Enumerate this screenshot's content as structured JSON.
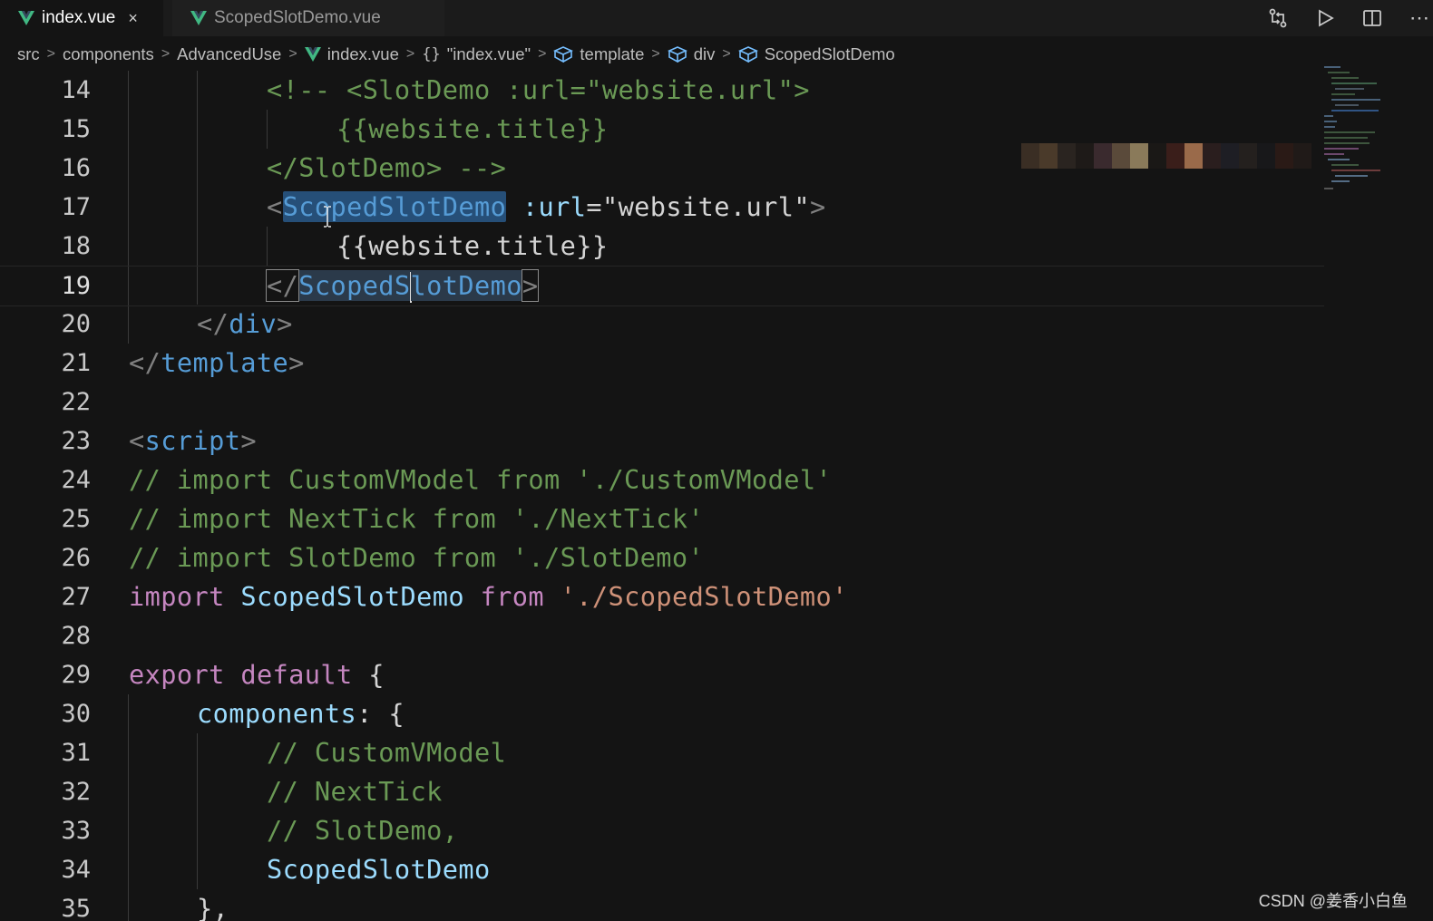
{
  "tabs": [
    {
      "label": "index.vue",
      "active": true,
      "close": "×"
    },
    {
      "label": "ScopedSlotDemo.vue",
      "active": false
    }
  ],
  "breadcrumb": {
    "items": [
      "src",
      "components",
      "AdvancedUse",
      "index.vue",
      "\"index.vue\"",
      "template",
      "div",
      "ScopedSlotDemo"
    ],
    "separator": ">"
  },
  "editor": {
    "line_numbers": [
      "14",
      "15",
      "16",
      "17",
      "18",
      "19",
      "20",
      "21",
      "22",
      "23",
      "24",
      "25",
      "26",
      "27",
      "28",
      "29",
      "30",
      "31",
      "32",
      "33",
      "34",
      "35"
    ],
    "lines": {
      "l14": "<!-- <SlotDemo :url=\"website.url\">",
      "l15": "{{website.title}}",
      "l16": "</SlotDemo> -->",
      "l17_open": "<",
      "l17_name": "ScopedSlotDemo",
      "l17_attr": ":url",
      "l17_eq": "=",
      "l17_val": "\"website.url\"",
      "l17_close": ">",
      "l18_open": "{{",
      "l18_expr": "website.title",
      "l18_close": "}}",
      "l19_open": "</",
      "l19_name_a": "ScopedS",
      "l19_name_b": "lotDemo",
      "l19_close": ">",
      "l20_open": "</",
      "l20_name": "div",
      "l20_close": ">",
      "l21_open": "</",
      "l21_name": "template",
      "l21_close": ">",
      "l23_open": "<",
      "l23_name": "script",
      "l23_close": ">",
      "l24": "// import CustomVModel from './CustomVModel'",
      "l25": "// import NextTick from './NextTick'",
      "l26": "// import SlotDemo from './SlotDemo'",
      "l27_kw": "import",
      "l27_name": "ScopedSlotDemo",
      "l27_from": "from",
      "l27_str": "'./ScopedSlotDemo'",
      "l29_kw1": "export",
      "l29_kw2": "default",
      "l29_brace": "{",
      "l30_key": "components",
      "l30_rest": ": {",
      "l31": "// CustomVModel",
      "l32": "// NextTick",
      "l33": "// SlotDemo,",
      "l34": "ScopedSlotDemo",
      "l35": "},"
    }
  },
  "watermark": "CSDN @姜香小白鱼",
  "colors": {
    "background": "#141414",
    "comment": "#6a9955",
    "tag": "#569cd6",
    "component": "#4ec9b0",
    "attribute": "#9cdcfe",
    "string": "#ce9178",
    "keyword": "#c586c0",
    "selection": "#264f78"
  },
  "icons": [
    "vue-logo-icon",
    "close-icon",
    "source-control-compare-icon",
    "run-icon",
    "split-editor-icon",
    "more-actions-icon",
    "braces-icon",
    "symbol-cube-icon",
    "chevron-right-icon",
    "text-cursor-icon"
  ]
}
